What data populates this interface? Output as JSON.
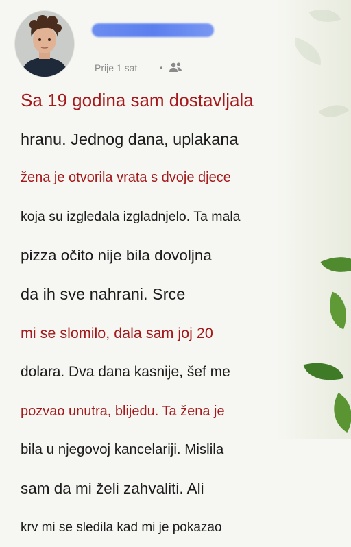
{
  "post": {
    "author_name": "",
    "time": "Prije 1 sat",
    "dot": "•",
    "audience_icon": "friends-icon"
  },
  "lines": [
    {
      "text": "Sa 19 godina sam dostavljala",
      "color": "red"
    },
    {
      "text": "hranu. Jednog dana, uplakana",
      "color": "dark"
    },
    {
      "text": "žena je otvorila vrata s dvoje djece",
      "color": "red"
    },
    {
      "text": "koja su izgledala izgladnjelo. Ta mala",
      "color": "dark"
    },
    {
      "text": "pizza očito nije bila dovoljna",
      "color": "dark"
    },
    {
      "text": "da ih sve nahrani. Srce",
      "color": "dark"
    },
    {
      "text": "mi se slomilo, dala sam joj 20",
      "color": "red"
    },
    {
      "text": "dolara. Dva dana kasnije, šef me",
      "color": "dark"
    },
    {
      "text": "pozvao unutra, blijedu. Ta žena je",
      "color": "red"
    },
    {
      "text": "bila u njegovoj kancelariji. Mislila",
      "color": "dark"
    },
    {
      "text": "sam da mi želi zahvaliti. Ali",
      "color": "dark"
    },
    {
      "text": "krv mi se sledila kad mi je pokazao",
      "color": "dark"
    }
  ],
  "colors": {
    "red": "#a5191c",
    "dark": "#1c1c1c",
    "meta": "#8a8a8a"
  }
}
